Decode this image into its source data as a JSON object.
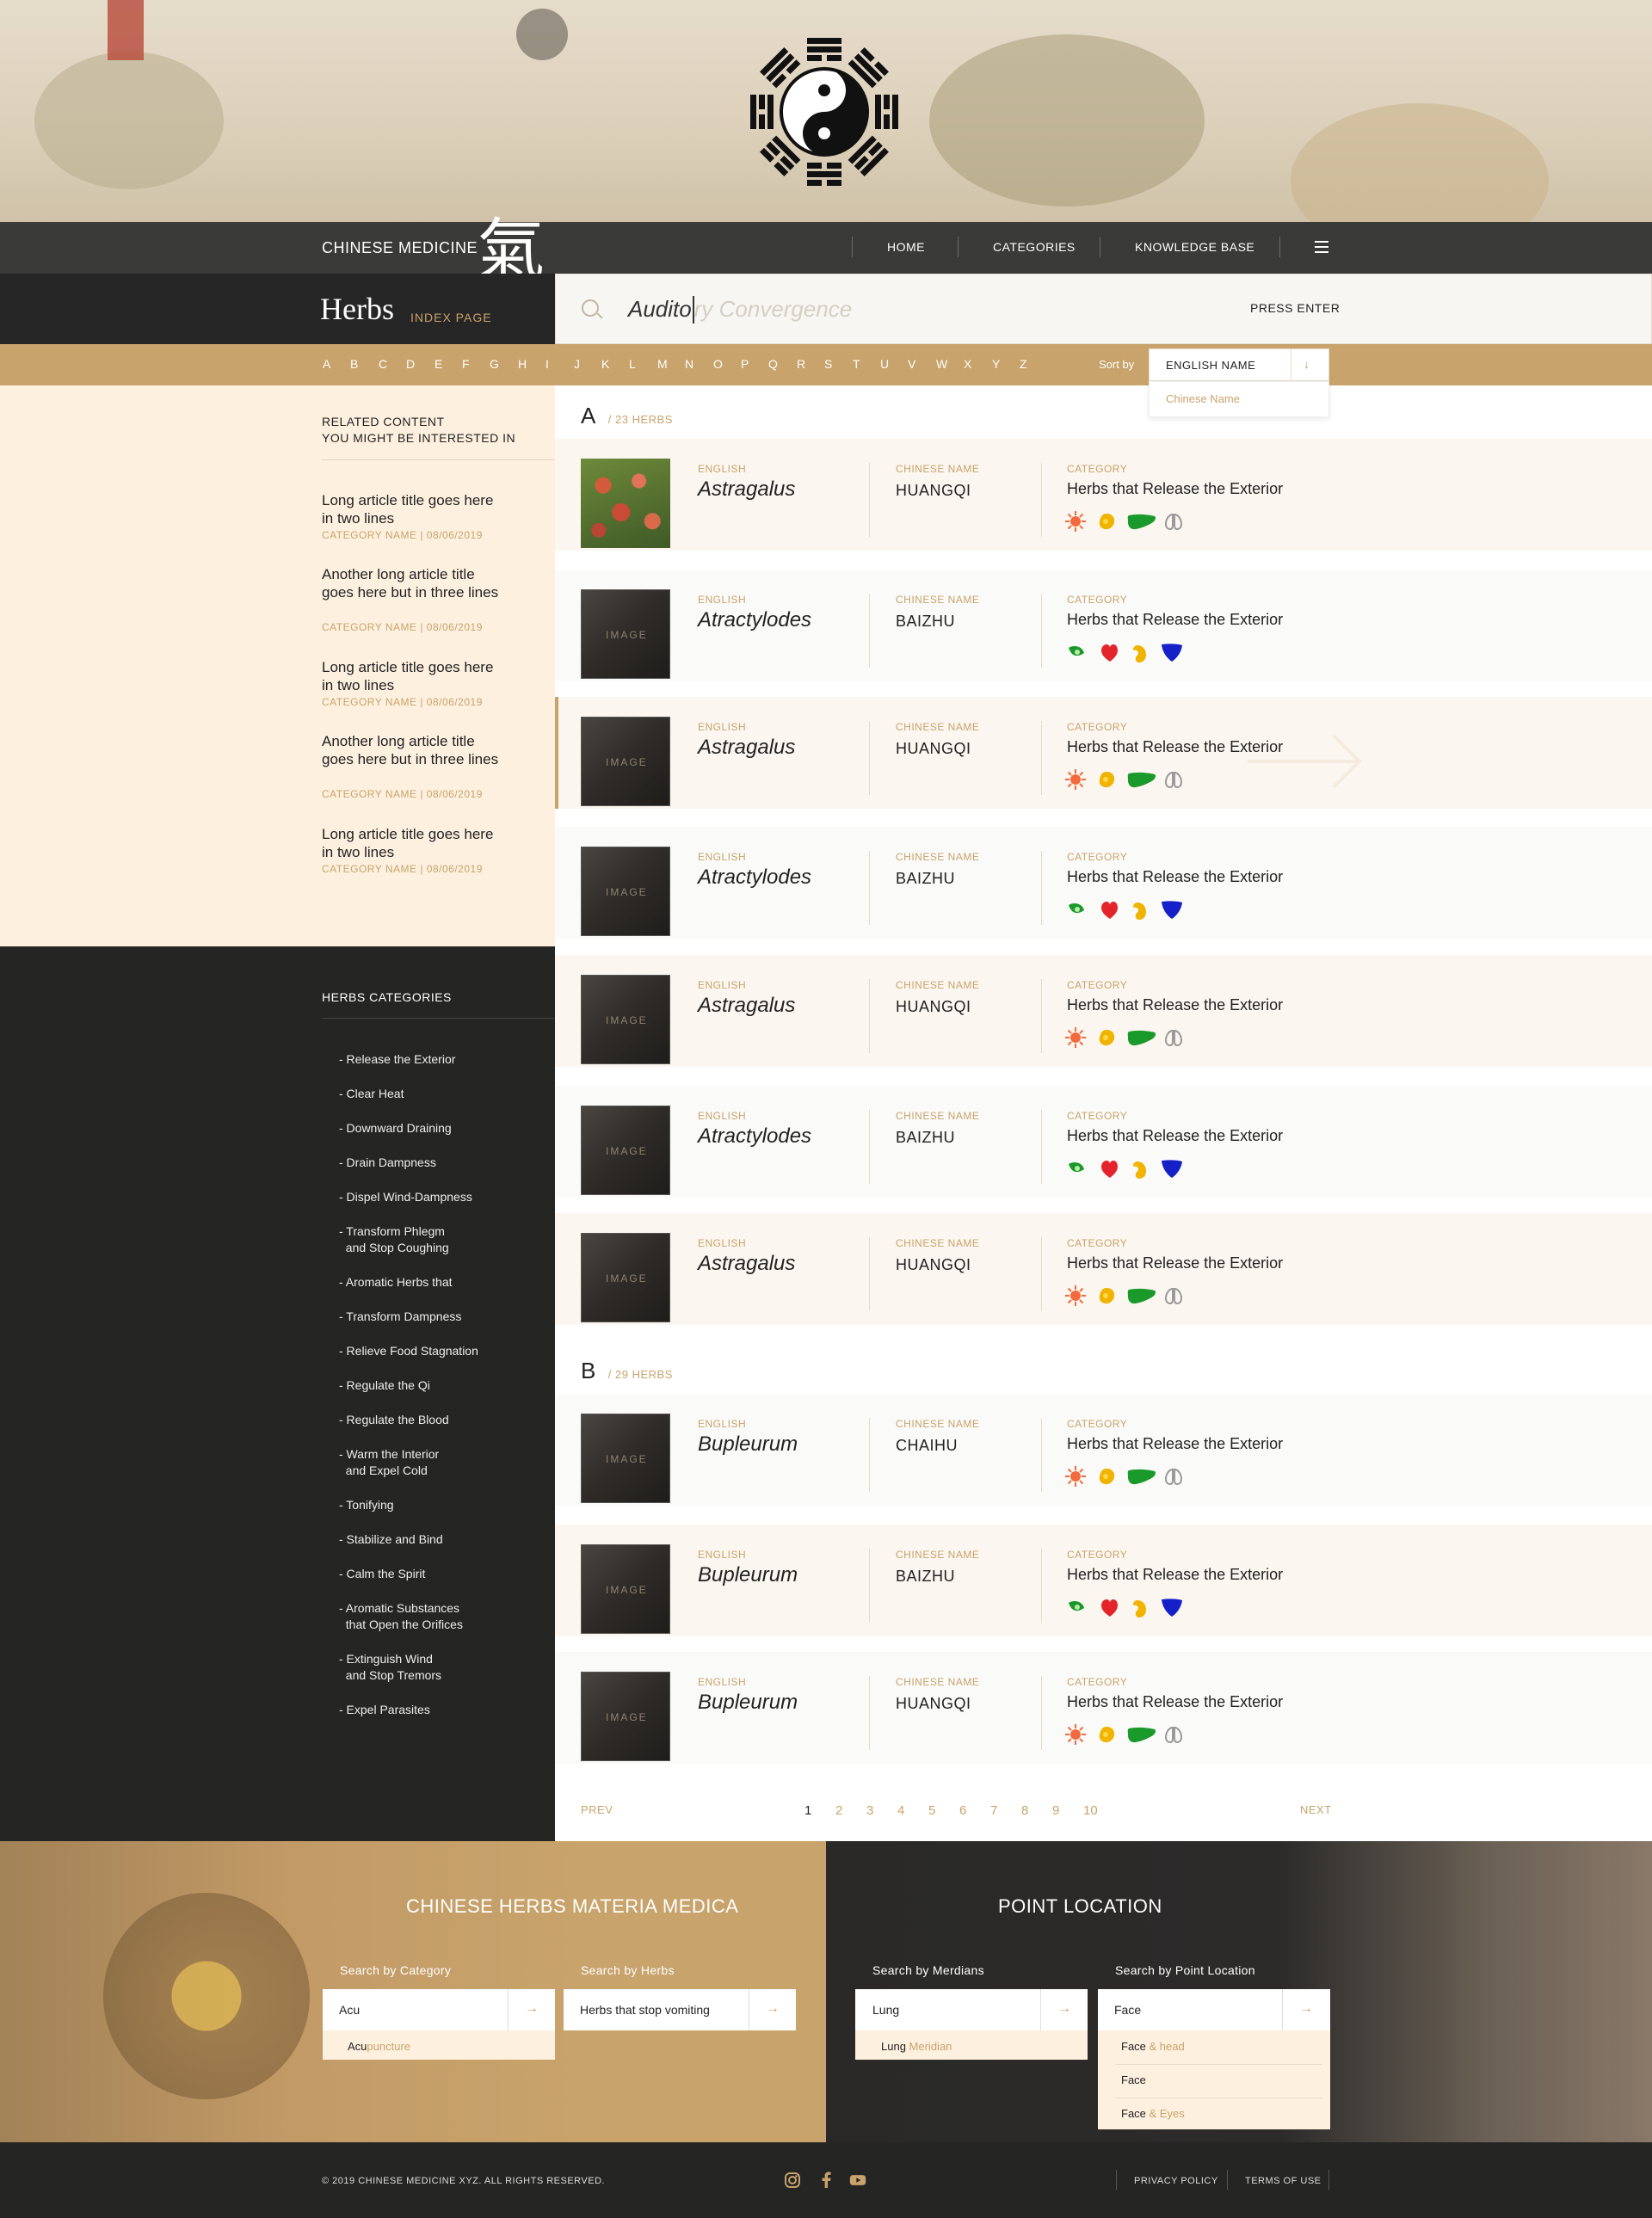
{
  "brand": {
    "name": "CHINESE MEDICINE",
    "glyph": "氣"
  },
  "nav": {
    "home": "HOME",
    "categories": "CATEGORIES",
    "knowledge_base": "KNOWLEDGE BASE"
  },
  "page": {
    "title": "Herbs",
    "subtitle": "INDEX PAGE"
  },
  "search": {
    "typed": "Audito",
    "hint": "ry Convergence",
    "press_enter": "PRESS ENTER"
  },
  "alphabet": [
    "A",
    "B",
    "C",
    "D",
    "E",
    "F",
    "G",
    "H",
    "I",
    "J",
    "K",
    "L",
    "M",
    "N",
    "O",
    "P",
    "Q",
    "R",
    "S",
    "T",
    "U",
    "V",
    "W",
    "X",
    "Y",
    "Z"
  ],
  "sort": {
    "label": "Sort by",
    "selected": "ENGLISH NAME",
    "option": "Chinese Name"
  },
  "related": {
    "title_line1": "RELATED CONTENT",
    "title_line2": "YOU MIGHT BE INTERESTED IN",
    "articles": [
      {
        "title": "Long article title goes here in two lines",
        "meta": "CATEGORY NAME  |  08/06/2019"
      },
      {
        "title": "Another long article title goes here but in three lines",
        "meta": "CATEGORY NAME  |  08/06/2019"
      },
      {
        "title": "Long article title goes here in two lines",
        "meta": "CATEGORY NAME  |  08/06/2019"
      },
      {
        "title": "Another long article title goes here but in three lines",
        "meta": "CATEGORY NAME  |  08/06/2019"
      },
      {
        "title": "Long article title goes here in two lines",
        "meta": "CATEGORY NAME  |  08/06/2019"
      }
    ]
  },
  "categories": {
    "title": "HERBS CATEGORIES",
    "items": [
      "- Release the Exterior",
      "- Clear Heat",
      "- Downward Draining",
      "- Drain Dampness",
      "- Dispel Wind-Dampness",
      "- Transform Phlegm\n  and Stop Coughing",
      "- Aromatic Herbs that",
      "- Transform Dampness",
      "- Relieve Food Stagnation",
      "- Regulate the Qi",
      "- Regulate the Blood",
      "- Warm the Interior\n  and Expel Cold",
      "- Tonifying",
      "- Stabilize and Bind",
      "- Calm the Spirit",
      "- Aromatic Substances\n  that Open the Orifices",
      "- Extinguish Wind\n  and Stop Tremors",
      "- Expel Parasites"
    ]
  },
  "labels": {
    "english": "ENGLISH",
    "chinese": "CHINESE NAME",
    "category": "CATEGORY",
    "image": "IMAGE"
  },
  "groups": [
    {
      "letter": "A",
      "count": "/  23 HERBS"
    },
    {
      "letter": "B",
      "count": "/  29 HERBS"
    }
  ],
  "herbs": [
    {
      "english": "Astragalus",
      "chinese": "HUANGQI",
      "category": "Herbs that Release the Exterior",
      "organs": "warm"
    },
    {
      "english": "Atractylodes",
      "chinese": "BAIZHU",
      "category": "Herbs that Release the Exterior",
      "organs": "cool"
    },
    {
      "english": "Astragalus",
      "chinese": "HUANGQI",
      "category": "Herbs that Release the Exterior",
      "organs": "warm"
    },
    {
      "english": "Atractylodes",
      "chinese": "BAIZHU",
      "category": "Herbs that Release the Exterior",
      "organs": "cool"
    },
    {
      "english": "Astragalus",
      "chinese": "HUANGQI",
      "category": "Herbs that Release the Exterior",
      "organs": "warm"
    },
    {
      "english": "Atractylodes",
      "chinese": "BAIZHU",
      "category": "Herbs that Release the Exterior",
      "organs": "cool"
    },
    {
      "english": "Astragalus",
      "chinese": "HUANGQI",
      "category": "Herbs that Release the Exterior",
      "organs": "warm"
    },
    {
      "english": "Bupleurum",
      "chinese": "CHAIHU",
      "category": "Herbs that Release the Exterior",
      "organs": "warm"
    },
    {
      "english": "Bupleurum",
      "chinese": "BAIZHU",
      "category": "Herbs that Release the Exterior",
      "organs": "cool"
    },
    {
      "english": "Bupleurum",
      "chinese": "HUANGQI",
      "category": "Herbs that Release the Exterior",
      "organs": "warm"
    }
  ],
  "pagination": {
    "prev": "PREV",
    "next": "NEXT",
    "pages": [
      "1",
      "2",
      "3",
      "4",
      "5",
      "6",
      "7",
      "8",
      "9",
      "10"
    ],
    "current": "1"
  },
  "materia": {
    "title": "CHINESE HERBS MATERIA MEDICA",
    "cat_label": "Search by Category",
    "cat_value": "Acu",
    "cat_sugg_pre": "Acu",
    "cat_sugg_hl": "puncture",
    "herb_label": "Search by Herbs",
    "herb_value": "Herbs that stop vomiting"
  },
  "point": {
    "title": "POINT LOCATION",
    "mer_label": "Search by Merdians",
    "mer_value": "Lung",
    "mer_sugg_pre": "Lung ",
    "mer_sugg_hl": "Meridian",
    "loc_label": "Search by Point Location",
    "loc_value": "Face",
    "loc_sugg": [
      {
        "pre": "Face",
        "hl": " & head"
      },
      {
        "pre": "Face",
        "hl": ""
      },
      {
        "pre": "Face",
        "hl": " & Eyes"
      }
    ]
  },
  "footer": {
    "copyright": "© 2019 CHINESE MEDICINE XYZ. ALL RIGHTS RESERVED.",
    "privacy": "PRIVACY POLICY",
    "terms": "TERMS OF USE"
  },
  "colors": {
    "gold": "#c8a36b",
    "dark": "#252524",
    "cream": "#fdf0df"
  }
}
